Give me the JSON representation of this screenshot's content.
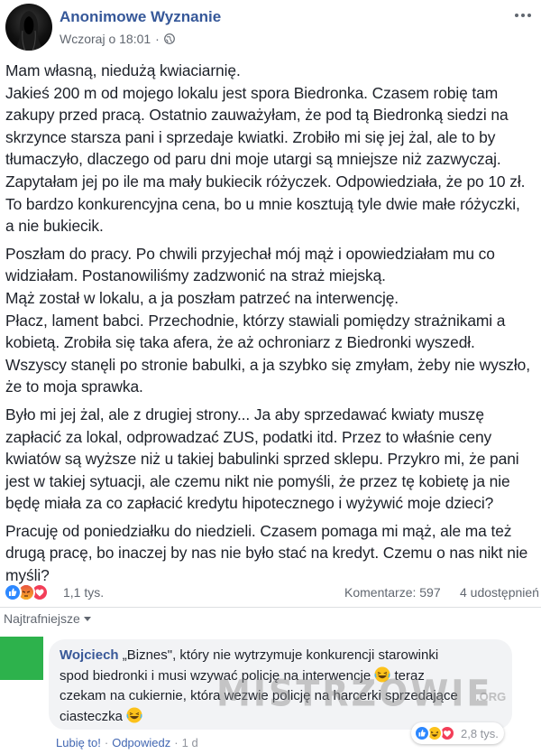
{
  "post": {
    "author": "Anonimowe Wyznanie",
    "time": "Wczoraj o 18:01",
    "separator": "·",
    "paragraphs": [
      [
        "Mam własną, niedużą kwiaciarnię.",
        "Jakieś 200 m od mojego lokalu jest spora Biedronka. Czasem robię tam",
        "zakupy przed pracą. Ostatnio zauważyłam, że pod tą Biedronką siedzi na",
        "skrzynce starsza pani i sprzedaje kwiatki. Zrobiło mi się jej żal, ale to by",
        "tłumaczyło, dlaczego od paru dni moje utargi są mniejsze niż zazwyczaj.",
        "Zapytałam jej po ile ma mały bukiecik różyczek. Odpowiedziała, że po 10 zł.",
        "To bardzo konkurencyjna cena, bo u mnie kosztują tyle dwie małe różyczki,",
        "a nie bukiecik."
      ],
      [
        "Poszłam do pracy. Po chwili przyjechał mój mąż i opowiedziałam mu co",
        "widziałam. Postanowiliśmy zadzwonić na straż miejską.",
        "Mąż został w lokalu, a ja poszłam patrzeć na interwencję.",
        "Płacz, lament babci. Przechodnie, którzy stawiali pomiędzy strażnikami a",
        "kobietą. Zrobiła się taka afera, że aż ochroniarz z Biedronki wyszedł.",
        "Wszyscy stanęli po stronie babulki, a ja szybko się zmyłam, żeby nie wyszło,",
        "że to moja sprawka."
      ],
      [
        "Było mi jej żal, ale z drugiej strony... Ja aby sprzedawać kwiaty muszę",
        "zapłacić za lokal, odprowadzać ZUS, podatki itd. Przez to właśnie ceny",
        "kwiatów są wyższe niż u takiej babulinki sprzed sklepu. Przykro mi, że pani",
        "jest w takiej sytuacji, ale czemu nikt nie pomyśli, że przez tę kobietę ja nie",
        "będę miała za co zapłacić kredytu hipotecznego i wyżywić moje dzieci?"
      ],
      [
        "Pracuję od poniedziałku do niedzieli. Czasem pomaga mi mąż, ale ma też",
        "drugą pracę, bo inaczej by nas nie było stać na kredyt. Czemu o nas nikt nie",
        "myśli?"
      ]
    ],
    "reaction_count": "1,1 tys.",
    "comments": "Komentarze: 597",
    "shares": "4 udostępnień",
    "sort_label": "Najtrafniejsze"
  },
  "comment": {
    "author": "Wojciech",
    "line1": "„Biznes\", który nie wytrzymuje konkurencji starowinki",
    "line2": "spod biedronki i musi wzywać policję na interwencje",
    "line2_tail": "teraz",
    "line3": "czekam na cukiernie, która wezwie policję na harcerki sprzedające",
    "line4": "ciasteczka",
    "reaction_count": "2,8 tys.",
    "like": "Lubię to!",
    "reply": "Odpowiedz",
    "time": "1 d",
    "dot": "·"
  },
  "watermark": {
    "text": "MISTRZOWIE",
    "suffix": ".ORG"
  },
  "colors": {
    "link_blue": "#365899",
    "like_blue": "#2d88ff",
    "angry_red": "#f25268",
    "love_red": "#f33e58",
    "comment_avatar_green": "#2db24c",
    "bubble_gray": "#f2f3f5"
  },
  "icons": [
    "globe-icon",
    "more-options-icon",
    "like-reaction-icon",
    "angry-reaction-icon",
    "love-reaction-icon",
    "haha-reaction-icon",
    "caret-down-icon",
    "laughing-emoji-icon"
  ]
}
